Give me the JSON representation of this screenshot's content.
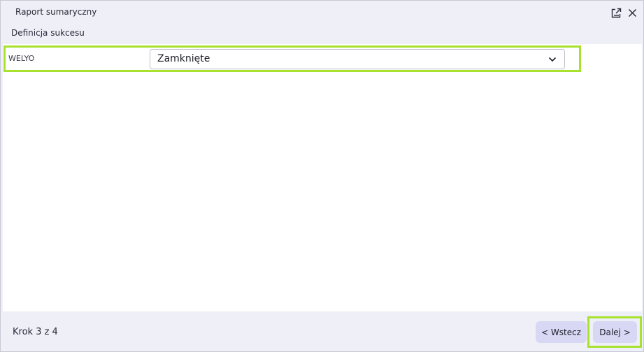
{
  "window": {
    "title": "Raport sumaryczny",
    "maximize_icon": "pop-out-icon",
    "close_icon": "close-icon"
  },
  "section": {
    "title": "Definicja sukcesu"
  },
  "field": {
    "label": "WELYO",
    "value": "Zamknięte",
    "chevron_icon": "chevron-down-icon"
  },
  "footer": {
    "step_text": "Krok 3 z 4",
    "back_label": "< Wstecz",
    "next_label": "Dalej >"
  },
  "colors": {
    "background": "#efeff7",
    "button": "#d8d8f4",
    "highlight": "#a6e22e"
  }
}
